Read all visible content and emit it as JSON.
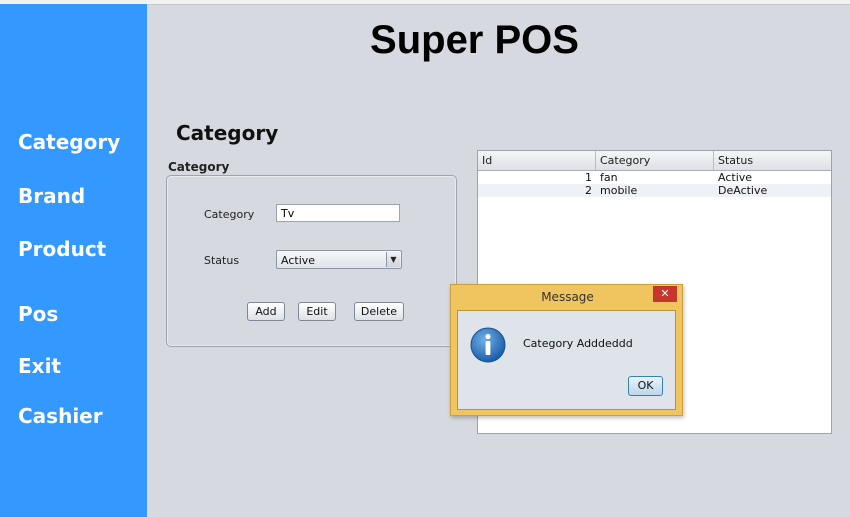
{
  "app": {
    "title": "Super POS"
  },
  "sidebar": {
    "items": [
      {
        "label": "Category"
      },
      {
        "label": "Brand"
      },
      {
        "label": "Product"
      },
      {
        "label": "Pos"
      },
      {
        "label": "Exit"
      },
      {
        "label": "Cashier"
      }
    ]
  },
  "section": {
    "title": "Category"
  },
  "form": {
    "panel_title": "Category",
    "category_label": "Category",
    "category_value": "Tv",
    "status_label": "Status",
    "status_selected": "Active",
    "add_label": "Add",
    "edit_label": "Edit",
    "delete_label": "Delete"
  },
  "table": {
    "columns": [
      "Id",
      "Category",
      "Status"
    ],
    "rows": [
      {
        "id": "1",
        "category": "fan",
        "status": "Active"
      },
      {
        "id": "2",
        "category": "mobile",
        "status": "DeActive"
      }
    ]
  },
  "dialog": {
    "title": "Message",
    "close_glyph": "✕",
    "message": "Category Adddeddd",
    "ok_label": "OK",
    "icon": "info-icon"
  },
  "colors": {
    "sidebar": "#3399ff",
    "background": "#d6d9e0",
    "dialog_frame": "#f0c45e",
    "close_button": "#c7362b"
  }
}
